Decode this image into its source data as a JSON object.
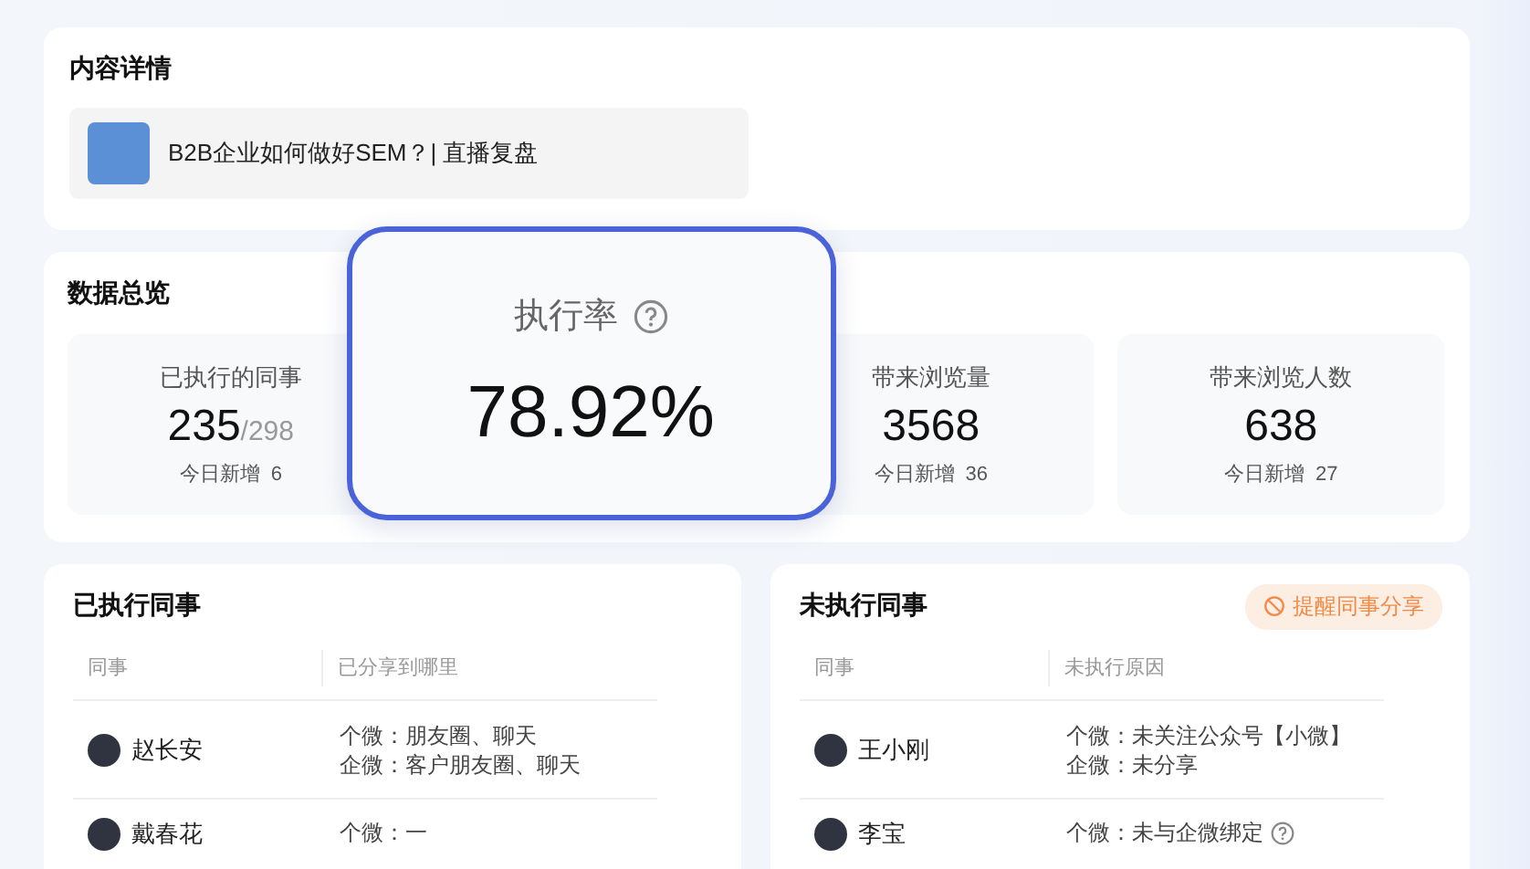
{
  "content_detail": {
    "title": "内容详情",
    "item": {
      "title": "B2B企业如何做好SEM？| 直播复盘"
    }
  },
  "overview": {
    "title": "数据总览",
    "stats": [
      {
        "label": "已执行的同事",
        "value": "235",
        "total": "/298",
        "today_label": "今日新增",
        "today_value": "6",
        "highlighted": false,
        "help": false
      },
      {
        "label": "执行率",
        "value": "78.92%",
        "highlighted": true,
        "help": true
      },
      {
        "label": "带来浏览量",
        "value": "3568",
        "today_label": "今日新增",
        "today_value": "36",
        "highlighted": false,
        "help": false
      },
      {
        "label": "带来浏览人数",
        "value": "638",
        "today_label": "今日新增",
        "today_value": "27",
        "highlighted": false,
        "help": false
      }
    ]
  },
  "tables": [
    {
      "title": "已执行同事",
      "columns": [
        "同事",
        "已分享到哪里"
      ],
      "rows": [
        {
          "name": "赵长安",
          "lines": [
            {
              "text": "个微：朋友圈、聊天",
              "help": false
            },
            {
              "text": "企微：客户朋友圈、聊天",
              "help": false
            }
          ]
        },
        {
          "name": "戴春花",
          "lines": [
            {
              "text": "个微：一",
              "help": false
            }
          ]
        }
      ]
    },
    {
      "title": "未执行同事",
      "action": "提醒同事分享",
      "columns": [
        "同事",
        "未执行原因"
      ],
      "rows": [
        {
          "name": "王小刚",
          "lines": [
            {
              "text": "个微：未关注公众号【小微】",
              "help": false
            },
            {
              "text": "企微：未分享",
              "help": false
            }
          ]
        },
        {
          "name": "李宝",
          "lines": [
            {
              "text": "个微：未与企微绑定",
              "help": true
            }
          ]
        }
      ]
    }
  ]
}
